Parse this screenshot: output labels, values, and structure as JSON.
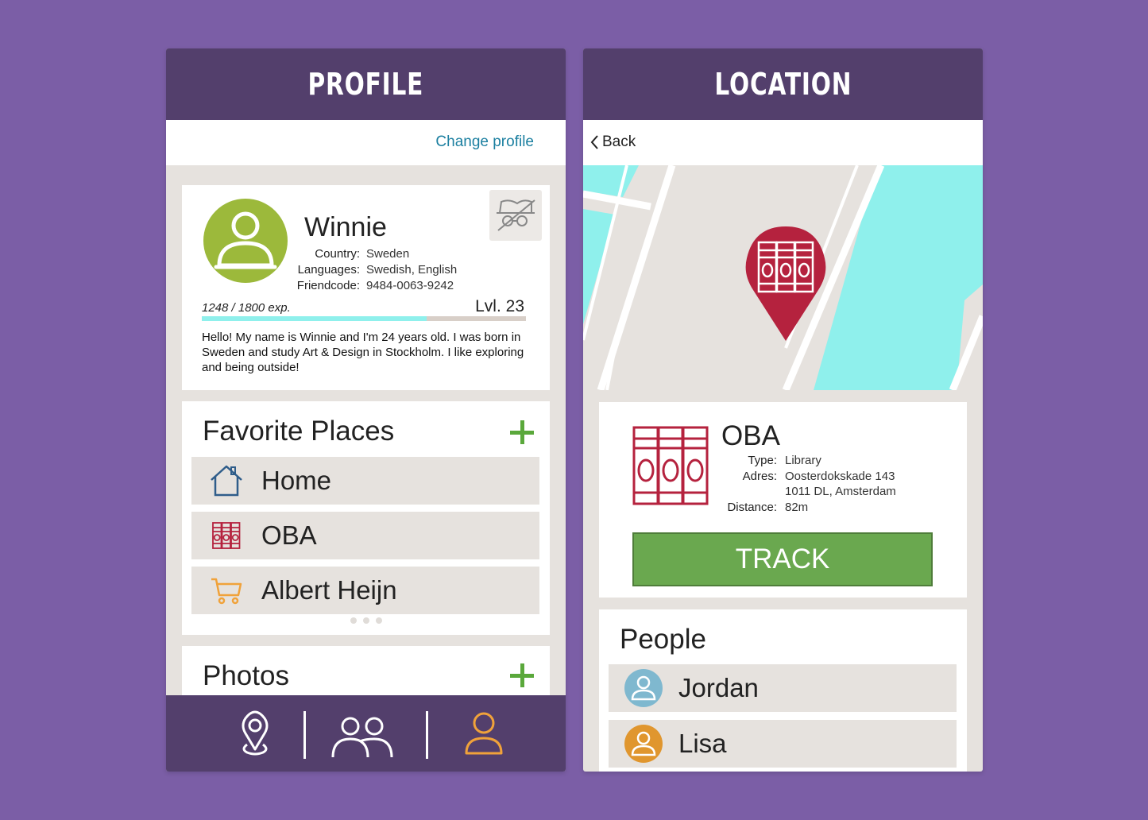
{
  "profile_screen": {
    "header_title": "PROFILE",
    "change_profile": "Change profile",
    "user": {
      "name": "Winnie",
      "country_label": "Country:",
      "country": "Sweden",
      "languages_label": "Languages:",
      "languages": "Swedish, English",
      "friendcode_label": "Friendcode:",
      "friendcode": "9484-0063-9242",
      "exp_text": "1248 / 1800 exp.",
      "exp_current": 1248,
      "exp_max": 1800,
      "level": "Lvl. 23",
      "bio": "Hello! My name is Winnie and I'm 24 years old. I was born in Sweden and study Art & Design in Stockholm. I like exploring and being outside!"
    },
    "favorites": {
      "title": "Favorite Places",
      "items": [
        {
          "label": "Home",
          "icon": "home-icon"
        },
        {
          "label": "OBA",
          "icon": "library-icon"
        },
        {
          "label": "Albert Heijn",
          "icon": "cart-icon"
        }
      ]
    },
    "photos": {
      "title": "Photos"
    },
    "nav": [
      {
        "icon": "location-pin-icon"
      },
      {
        "icon": "people-icon"
      },
      {
        "icon": "person-icon",
        "active": true
      }
    ]
  },
  "location_screen": {
    "header_title": "LOCATION",
    "back_label": "Back",
    "place": {
      "name": "OBA",
      "type_label": "Type:",
      "type": "Library",
      "address_label": "Adres:",
      "address_line1": "Oosterdokskade 143",
      "address_line2": "1011 DL, Amsterdam",
      "distance_label": "Distance:",
      "distance": "82m"
    },
    "track_label": "TRACK",
    "people": {
      "title": "People",
      "items": [
        {
          "name": "Jordan",
          "avatar_color": "#7fb8cf"
        },
        {
          "name": "Lisa",
          "avatar_color": "#e0962e"
        }
      ]
    }
  },
  "colors": {
    "background": "#7b5ea6",
    "header": "#533f6c",
    "link": "#1b7fa0",
    "avatar": "#9cb93b",
    "accent_green": "#6aa84f",
    "library_red": "#b5223e",
    "water": "#8ff0ec",
    "nav_active": "#f0a23a"
  }
}
